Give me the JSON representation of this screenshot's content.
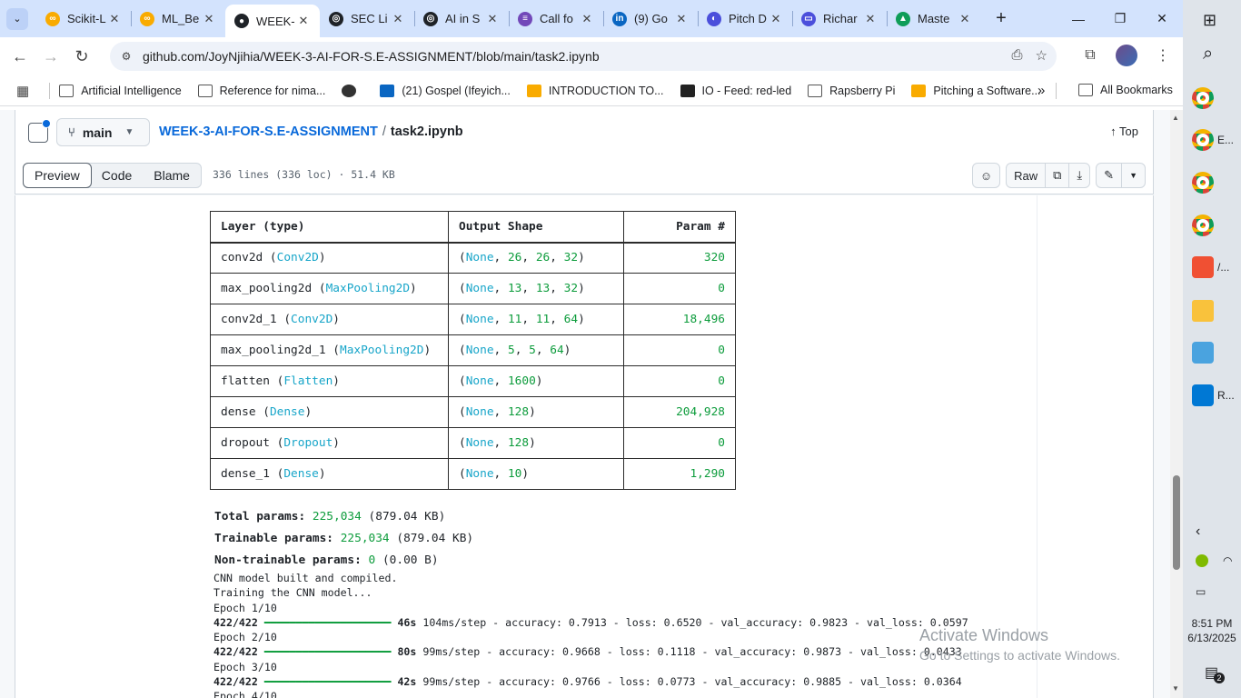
{
  "browser": {
    "tabs": [
      {
        "title": "Scikit-L",
        "color": "#f9ab00",
        "glyph": "∞"
      },
      {
        "title": "ML_Be",
        "color": "#f9ab00",
        "glyph": "∞"
      },
      {
        "title": "WEEK-",
        "color": "#1f2328",
        "glyph": "●"
      },
      {
        "title": "SEC Li",
        "color": "#1f2328",
        "glyph": "◎"
      },
      {
        "title": "AI in S",
        "color": "#1f2328",
        "glyph": "◎"
      },
      {
        "title": "Call fo",
        "color": "#7248b9",
        "glyph": "≡"
      },
      {
        "title": "(9) Go",
        "color": "#0a66c2",
        "glyph": "in"
      },
      {
        "title": "Pitch D",
        "color": "#4b4fdb",
        "glyph": "◐"
      },
      {
        "title": "Richar",
        "color": "#4b4fdb",
        "glyph": "▭"
      },
      {
        "title": "Maste",
        "color": "#0f9d58",
        "glyph": "▲"
      }
    ],
    "active_tab_index": 2,
    "new_tab_label": "+",
    "url": "github.com/JoyNjihia/WEEK-3-AI-FOR-S.E-ASSIGNMENT/blob/main/task2.ipynb",
    "bookmarks": [
      {
        "label": "Artificial Intelligence",
        "icon": "folder"
      },
      {
        "label": "Reference for nima...",
        "icon": "folder"
      },
      {
        "label": "",
        "icon": "globe"
      },
      {
        "label": "(21) Gospel (Ifeyich...",
        "icon": "linkedin"
      },
      {
        "label": "INTRODUCTION TO...",
        "icon": "slides"
      },
      {
        "label": "IO - Feed: red-led",
        "icon": "io"
      },
      {
        "label": "Rapsberry Pi",
        "icon": "folder"
      },
      {
        "label": "Pitching a Software...",
        "icon": "slides"
      }
    ],
    "more_bookmarks": "»",
    "all_bookmarks": "All Bookmarks"
  },
  "github": {
    "branch": "main",
    "repo": "WEEK-3-AI-FOR-S.E-ASSIGNMENT",
    "separator": "/",
    "file": "task2.ipynb",
    "top_label": "Top",
    "view_tabs": [
      "Preview",
      "Code",
      "Blame"
    ],
    "file_info": "336 lines (336 loc) · 51.4 KB",
    "raw_label": "Raw"
  },
  "model_summary": {
    "headers": [
      "Layer (type)",
      "Output Shape",
      "Param #"
    ],
    "rows": [
      {
        "name": "conv2d",
        "type": "Conv2D",
        "shape": [
          "None",
          "26",
          "26",
          "32"
        ],
        "params": "320"
      },
      {
        "name": "max_pooling2d",
        "type": "MaxPooling2D",
        "shape": [
          "None",
          "13",
          "13",
          "32"
        ],
        "params": "0"
      },
      {
        "name": "conv2d_1",
        "type": "Conv2D",
        "shape": [
          "None",
          "11",
          "11",
          "64"
        ],
        "params": "18,496"
      },
      {
        "name": "max_pooling2d_1",
        "type": "MaxPooling2D",
        "shape": [
          "None",
          "5",
          "5",
          "64"
        ],
        "params": "0"
      },
      {
        "name": "flatten",
        "type": "Flatten",
        "shape": [
          "None",
          "1600"
        ],
        "params": "0"
      },
      {
        "name": "dense",
        "type": "Dense",
        "shape": [
          "None",
          "128"
        ],
        "params": "204,928"
      },
      {
        "name": "dropout",
        "type": "Dropout",
        "shape": [
          "None",
          "128"
        ],
        "params": "0"
      },
      {
        "name": "dense_1",
        "type": "Dense",
        "shape": [
          "None",
          "10"
        ],
        "params": "1,290"
      }
    ],
    "totals": [
      {
        "label": "Total params:",
        "value": "225,034",
        "size": "(879.04 KB)"
      },
      {
        "label": "Trainable params:",
        "value": "225,034",
        "size": "(879.04 KB)"
      },
      {
        "label": "Non-trainable params:",
        "value": "0",
        "size": "(0.00 B)"
      }
    ]
  },
  "log": {
    "lines": [
      {
        "kind": "text",
        "text": "CNN model built and compiled."
      },
      {
        "kind": "text",
        "text": "Training the CNN model..."
      },
      {
        "kind": "text",
        "text": "Epoch 1/10"
      },
      {
        "kind": "step",
        "steps": "422/422",
        "bar": "━━━━━━━━━━━━━━━━━━━━",
        "time": "46s",
        "rest": "104ms/step - accuracy: 0.7913 - loss: 0.6520 - val_accuracy: 0.9823 - val_loss: 0.0597"
      },
      {
        "kind": "text",
        "text": "Epoch 2/10"
      },
      {
        "kind": "step",
        "steps": "422/422",
        "bar": "━━━━━━━━━━━━━━━━━━━━",
        "time": "80s",
        "rest": "99ms/step - accuracy: 0.9668 - loss: 0.1118 - val_accuracy: 0.9873 - val_loss: 0.0433"
      },
      {
        "kind": "text",
        "text": "Epoch 3/10"
      },
      {
        "kind": "step",
        "steps": "422/422",
        "bar": "━━━━━━━━━━━━━━━━━━━━",
        "time": "42s",
        "rest": "99ms/step - accuracy: 0.9766 - loss: 0.0773 - val_accuracy: 0.9885 - val_loss: 0.0364"
      },
      {
        "kind": "text",
        "text": "Epoch 4/10"
      }
    ]
  },
  "watermark": {
    "line1": "Activate Windows",
    "line2": "Go to Settings to activate Windows."
  },
  "taskbar": {
    "items": [
      {
        "label": "",
        "kind": "chrome"
      },
      {
        "label": "E...",
        "kind": "chrome"
      },
      {
        "label": "",
        "kind": "chrome"
      },
      {
        "label": "",
        "kind": "chrome"
      },
      {
        "label": "/...",
        "kind": "git"
      },
      {
        "label": "",
        "kind": "folder"
      },
      {
        "label": "",
        "kind": "notes"
      },
      {
        "label": "R...",
        "kind": "vscode"
      }
    ],
    "time": "8:51 PM",
    "date": "6/13/2025",
    "notifications": "2"
  }
}
